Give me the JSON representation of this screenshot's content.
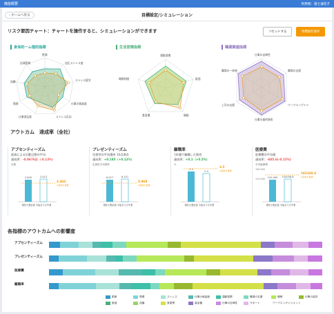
{
  "topbar": {
    "title": "機能概要",
    "user": "利用者：富士通花子"
  },
  "header": {
    "back": "ホームへ戻る",
    "title": "目標設定/シミュレーション"
  },
  "risk": {
    "title": "リスク要因チャート：チャートを操作すると、シミュレーションができます",
    "reset": "リセットする",
    "save": "目標値を保存"
  },
  "radars": [
    {
      "title": "身体的ーム理的指標",
      "color": "#2aa79b",
      "labels": [
        "肥満",
        "血圧ストレス度",
        "ストレス疲労",
        "仕事の裁量度",
        "ストレス反応",
        "仕事満足度",
        "喫煙",
        "血糖",
        "血清脂質"
      ]
    },
    {
      "title": "生活習慣指標",
      "color": "#4caf7a",
      "labels": [
        "運動習慣",
        "飲酒",
        "睡眠",
        "食習慣",
        "睡眠時間"
      ]
    },
    {
      "title": "職業関連指標",
      "color": "#8e6fbf",
      "labels": [
        "仕事の自律性",
        "職場の支援",
        "ワークエンゲイジ",
        "仕事の量的負担",
        "上司の支援",
        "職場の一体感"
      ]
    }
  ],
  "outcome": {
    "title": "アウトカム　達成率（全社）",
    "cards": [
      {
        "title": "アブセンティーズム",
        "desc": "疾病による欠勤日数の平均",
        "rate_label": "達成率：",
        "rate": "-0.0676日（-0.13%）",
        "rate_class": "neg",
        "unit": "日数",
        "bar1": "2.600",
        "bar2": "2.513",
        "target": "2.443",
        "target_label": "※定めた目標",
        "x1": "現在の測定値",
        "x2": "今後までの予測"
      },
      {
        "title": "プレゼンティーズム",
        "desc": "生産性の平均損失 10点満点",
        "rate_label": "達成率：",
        "rate": "+0.185（+0.12%）",
        "rate_class": "pos",
        "unit": "生産性平均損失",
        "bar1": "6.027",
        "bar2": "6.151",
        "target": "5.968",
        "target_label": "※定めた目標",
        "x1": "現在の測定値",
        "x2": "今後までの予測"
      },
      {
        "title": "離職率",
        "desc": "1年間で離職した割合",
        "rate_label": "達成率：",
        "rate": "+0.1（+0.5%）",
        "rate_class": "pos",
        "unit": "%",
        "bar1": "2.5",
        "bar2": "2.4",
        "target": "3.5",
        "target_label": "※定めた目標",
        "x1": "現在の測定値",
        "x2": "今後までの予測"
      },
      {
        "title": "医療費",
        "desc": "医療費の平均値",
        "rate_label": "達成率：",
        "rate": "-605.6(-0.15%)",
        "rate_class": "neg",
        "unit": "平均医療費",
        "bar1": "102,000",
        "bar2": "102058.8",
        "target": "102160.4",
        "target_label": "※定めた目標",
        "ytop": "140,000",
        "ymid": "110,000",
        "x1": "現在の測定値",
        "x2": "今後までの予測"
      }
    ]
  },
  "impact": {
    "title": "各指標のアウトカムへの影響度",
    "rows": [
      {
        "label": "アブセンティーズム",
        "segments": [
          {
            "c": "#3399cc",
            "v": 5
          },
          {
            "c": "#7fd3d8",
            "v": 8
          },
          {
            "c": "#a8e2d8",
            "v": 6
          },
          {
            "c": "#56b9b0",
            "v": 4
          },
          {
            "c": "#3dbfa8",
            "v": 5
          },
          {
            "c": "#7dd8c0",
            "v": 6
          },
          {
            "c": "#b6e85a",
            "v": 18
          },
          {
            "c": "#98b830",
            "v": 6
          },
          {
            "c": "#d4e048",
            "v": 35
          },
          {
            "c": "#8c78c8",
            "v": 6
          },
          {
            "c": "#c58cdc",
            "v": 8
          },
          {
            "c": "#e0b8e8",
            "v": 7
          },
          {
            "c": "#c877e0",
            "v": 6
          }
        ]
      },
      {
        "label": "プレゼンティーズム",
        "segments": [
          {
            "c": "#3399cc",
            "v": 4
          },
          {
            "c": "#7fd3d8",
            "v": 12
          },
          {
            "c": "#a8e2d8",
            "v": 8
          },
          {
            "c": "#56b9b0",
            "v": 4
          },
          {
            "c": "#3dbfa8",
            "v": 3
          },
          {
            "c": "#7dd8c0",
            "v": 6
          },
          {
            "c": "#b6e85a",
            "v": 20
          },
          {
            "c": "#98b830",
            "v": 4
          },
          {
            "c": "#d4e048",
            "v": 25
          },
          {
            "c": "#8c78c8",
            "v": 8
          },
          {
            "c": "#c58cdc",
            "v": 9
          },
          {
            "c": "#e0b8e8",
            "v": 6
          },
          {
            "c": "#c877e0",
            "v": 6
          }
        ]
      },
      {
        "label": "医療費",
        "segments": [
          {
            "c": "#3399cc",
            "v": 6
          },
          {
            "c": "#7fd3d8",
            "v": 14
          },
          {
            "c": "#a8e2d8",
            "v": 10
          },
          {
            "c": "#56b9b0",
            "v": 10
          },
          {
            "c": "#3dbfa8",
            "v": 6
          },
          {
            "c": "#7dd8c0",
            "v": 4
          },
          {
            "c": "#b6e85a",
            "v": 18
          },
          {
            "c": "#98b830",
            "v": 6
          },
          {
            "c": "#d4e048",
            "v": 16
          },
          {
            "c": "#8c78c8",
            "v": 6
          },
          {
            "c": "#c58cdc",
            "v": 8
          },
          {
            "c": "#e0b8e8",
            "v": 8
          },
          {
            "c": "#c877e0",
            "v": 6
          }
        ]
      },
      {
        "label": "離職率",
        "segments": [
          {
            "c": "#3399cc",
            "v": 4
          },
          {
            "c": "#7fd3d8",
            "v": 16
          },
          {
            "c": "#a8e2d8",
            "v": 10
          },
          {
            "c": "#56b9b0",
            "v": 5
          },
          {
            "c": "#3dbfa8",
            "v": 8
          },
          {
            "c": "#7dd8c0",
            "v": 4
          },
          {
            "c": "#b6e85a",
            "v": 6
          },
          {
            "c": "#98b830",
            "v": 8
          },
          {
            "c": "#d4e048",
            "v": 30
          },
          {
            "c": "#8c78c8",
            "v": 6
          },
          {
            "c": "#c58cdc",
            "v": 8
          },
          {
            "c": "#e0b8e8",
            "v": 6
          },
          {
            "c": "#c877e0",
            "v": 5
          }
        ]
      }
    ],
    "legend": [
      {
        "label": "肥満",
        "c": "#3399cc"
      },
      {
        "label": "喫煙",
        "c": "#7fd3d8"
      },
      {
        "label": "ストレス",
        "c": "#a8e2d8"
      },
      {
        "label": "仕事の裁量度",
        "c": "#56b9b0"
      },
      {
        "label": "運動習慣",
        "c": "#3dbfa8"
      },
      {
        "label": "職場の支援",
        "c": "#7dd8c0"
      },
      {
        "label": "睡眠",
        "c": "#b6e85a"
      },
      {
        "label": "仕事の量的",
        "c": "#98b830"
      },
      {
        "label": "飲酒",
        "c": "#4caf7a"
      },
      {
        "label": "血糖",
        "c": "#9ad26e"
      },
      {
        "label": "食習慣",
        "c": "#d4e048"
      },
      {
        "label": "高血糖",
        "c": "#8c78c8"
      },
      {
        "label": "仕事の自律性",
        "c": "#c58cdc"
      },
      {
        "label": "サポート",
        "c": "#e0b8e8"
      },
      {
        "label": "ワークエンゲイジメント",
        "c": "#c877e0"
      }
    ]
  }
}
